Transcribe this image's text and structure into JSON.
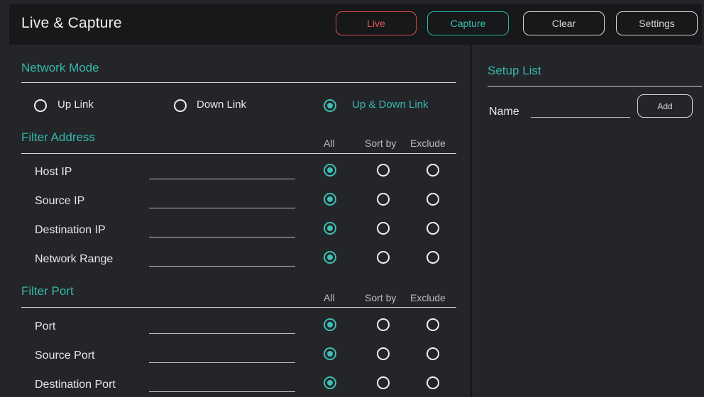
{
  "app": {
    "title": "Live & Capture"
  },
  "toolbar": {
    "live_label": "Live",
    "capture_label": "Capture",
    "clear_label": "Clear",
    "settings_label": "Settings"
  },
  "network_mode": {
    "title": "Network Mode",
    "options": [
      {
        "label": "Up Link",
        "checked": false
      },
      {
        "label": "Down Link",
        "checked": false
      },
      {
        "label": "Up & Down Link",
        "checked": true
      }
    ]
  },
  "filter_address": {
    "title": "Filter Address",
    "columns": [
      "All",
      "Sort by",
      "Exclude"
    ],
    "rows": [
      {
        "label": "Host IP",
        "value": "",
        "selected": "All"
      },
      {
        "label": "Source IP",
        "value": "",
        "selected": "All"
      },
      {
        "label": "Destination IP",
        "value": "",
        "selected": "All"
      },
      {
        "label": "Network Range",
        "value": "",
        "selected": "All"
      }
    ]
  },
  "filter_port": {
    "title": "Filter Port",
    "columns": [
      "All",
      "Sort by",
      "Exclude"
    ],
    "rows": [
      {
        "label": "Port",
        "value": "",
        "selected": "All"
      },
      {
        "label": "Source Port",
        "value": "",
        "selected": "All"
      },
      {
        "label": "Destination Port",
        "value": "",
        "selected": "All"
      }
    ]
  },
  "setup_list": {
    "title": "Setup List",
    "name_label": "Name",
    "name_value": "",
    "add_label": "Add"
  },
  "colors": {
    "accent": "#35b7ad",
    "live": "#e05555",
    "background": "#242528",
    "titlebar": "#17181a"
  }
}
